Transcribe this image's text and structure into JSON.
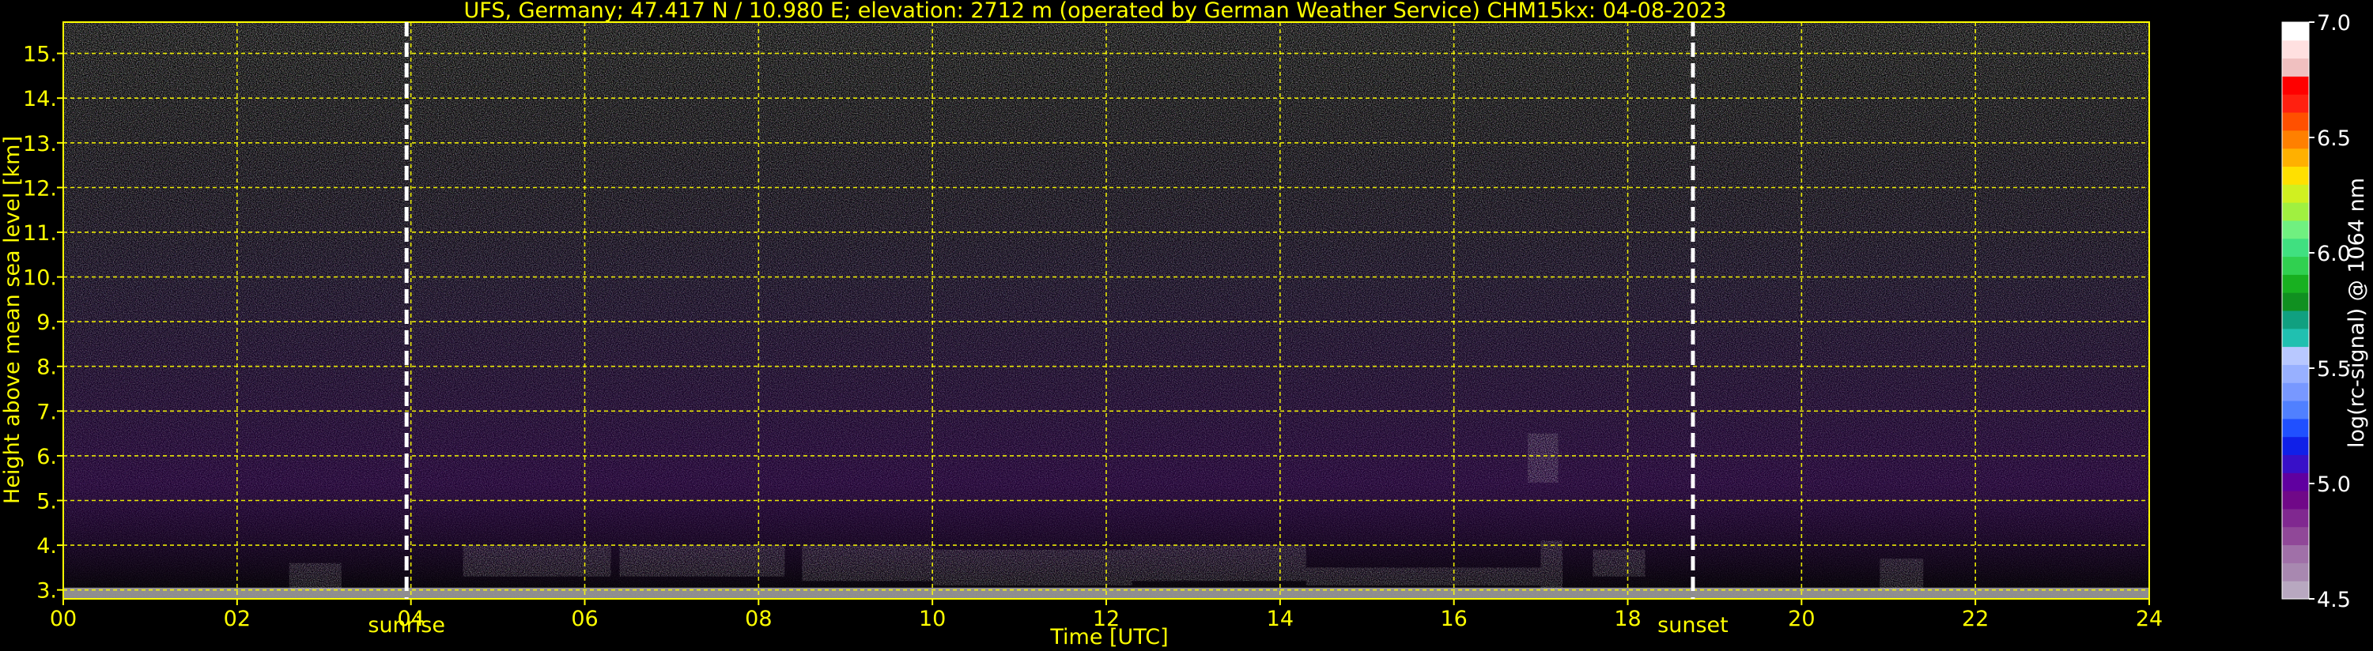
{
  "colors": {
    "background": "#000000",
    "text_yellow": "#ffff00",
    "text_white": "#ffffff",
    "grid": "#ffff00",
    "axes": "#ffff00",
    "day_marker": "#ffffff"
  },
  "chart_data": {
    "type": "heatmap",
    "title": "UFS, Germany; 47.417 N / 10.980 E; elevation: 2712 m  (operated by German Weather Service)    CHM15kx: 04-08-2023",
    "xlabel": "Time [UTC]",
    "ylabel": "Height above mean sea level [km]",
    "xlim": [
      0,
      24
    ],
    "ylim": [
      2.8,
      15.7
    ],
    "x_ticks": [
      0,
      2,
      4,
      6,
      8,
      10,
      12,
      14,
      16,
      18,
      20,
      22,
      24
    ],
    "x_tick_labels": [
      "00",
      "02",
      "04",
      "06",
      "08",
      "10",
      "12",
      "14",
      "16",
      "18",
      "20",
      "22",
      "24"
    ],
    "y_ticks": [
      3,
      4,
      5,
      6,
      7,
      8,
      9,
      10,
      11,
      12,
      13,
      14,
      15
    ],
    "y_tick_labels": [
      "3.",
      "4.",
      "5.",
      "6.",
      "7.",
      "8.",
      "9.",
      "10.",
      "11.",
      "12.",
      "13.",
      "14.",
      "15."
    ],
    "grid": true,
    "sunrise": {
      "x": 3.95,
      "label": "sunrise"
    },
    "sunset": {
      "x": 18.75,
      "label": "sunset"
    },
    "colorbar": {
      "label": "log(rc-signal) @ 1064 nm",
      "range": [
        4.5,
        7.0
      ],
      "ticks": [
        4.5,
        5.0,
        5.5,
        6.0,
        6.5,
        7.0
      ],
      "tick_labels": [
        "4.5",
        "5.0",
        "5.5",
        "6.0",
        "6.5",
        "7.0"
      ],
      "colors": [
        "#b8a8c0",
        "#a888b0",
        "#a070a8",
        "#904898",
        "#802890",
        "#700888",
        "#6000a0",
        "#3810c8",
        "#1020e8",
        "#2050ff",
        "#5080ff",
        "#7898ff",
        "#98b0ff",
        "#b8c8ff",
        "#20c0b0",
        "#10a080",
        "#109020",
        "#18b020",
        "#30d050",
        "#40e080",
        "#70f080",
        "#a0f040",
        "#d0f020",
        "#ffe000",
        "#ffb000",
        "#ff8000",
        "#ff5000",
        "#ff2010",
        "#ff0000",
        "#f0c0c0",
        "#ffe0e0",
        "#ffffff"
      ]
    },
    "annotations": [
      "sunrise",
      "sunset"
    ]
  }
}
